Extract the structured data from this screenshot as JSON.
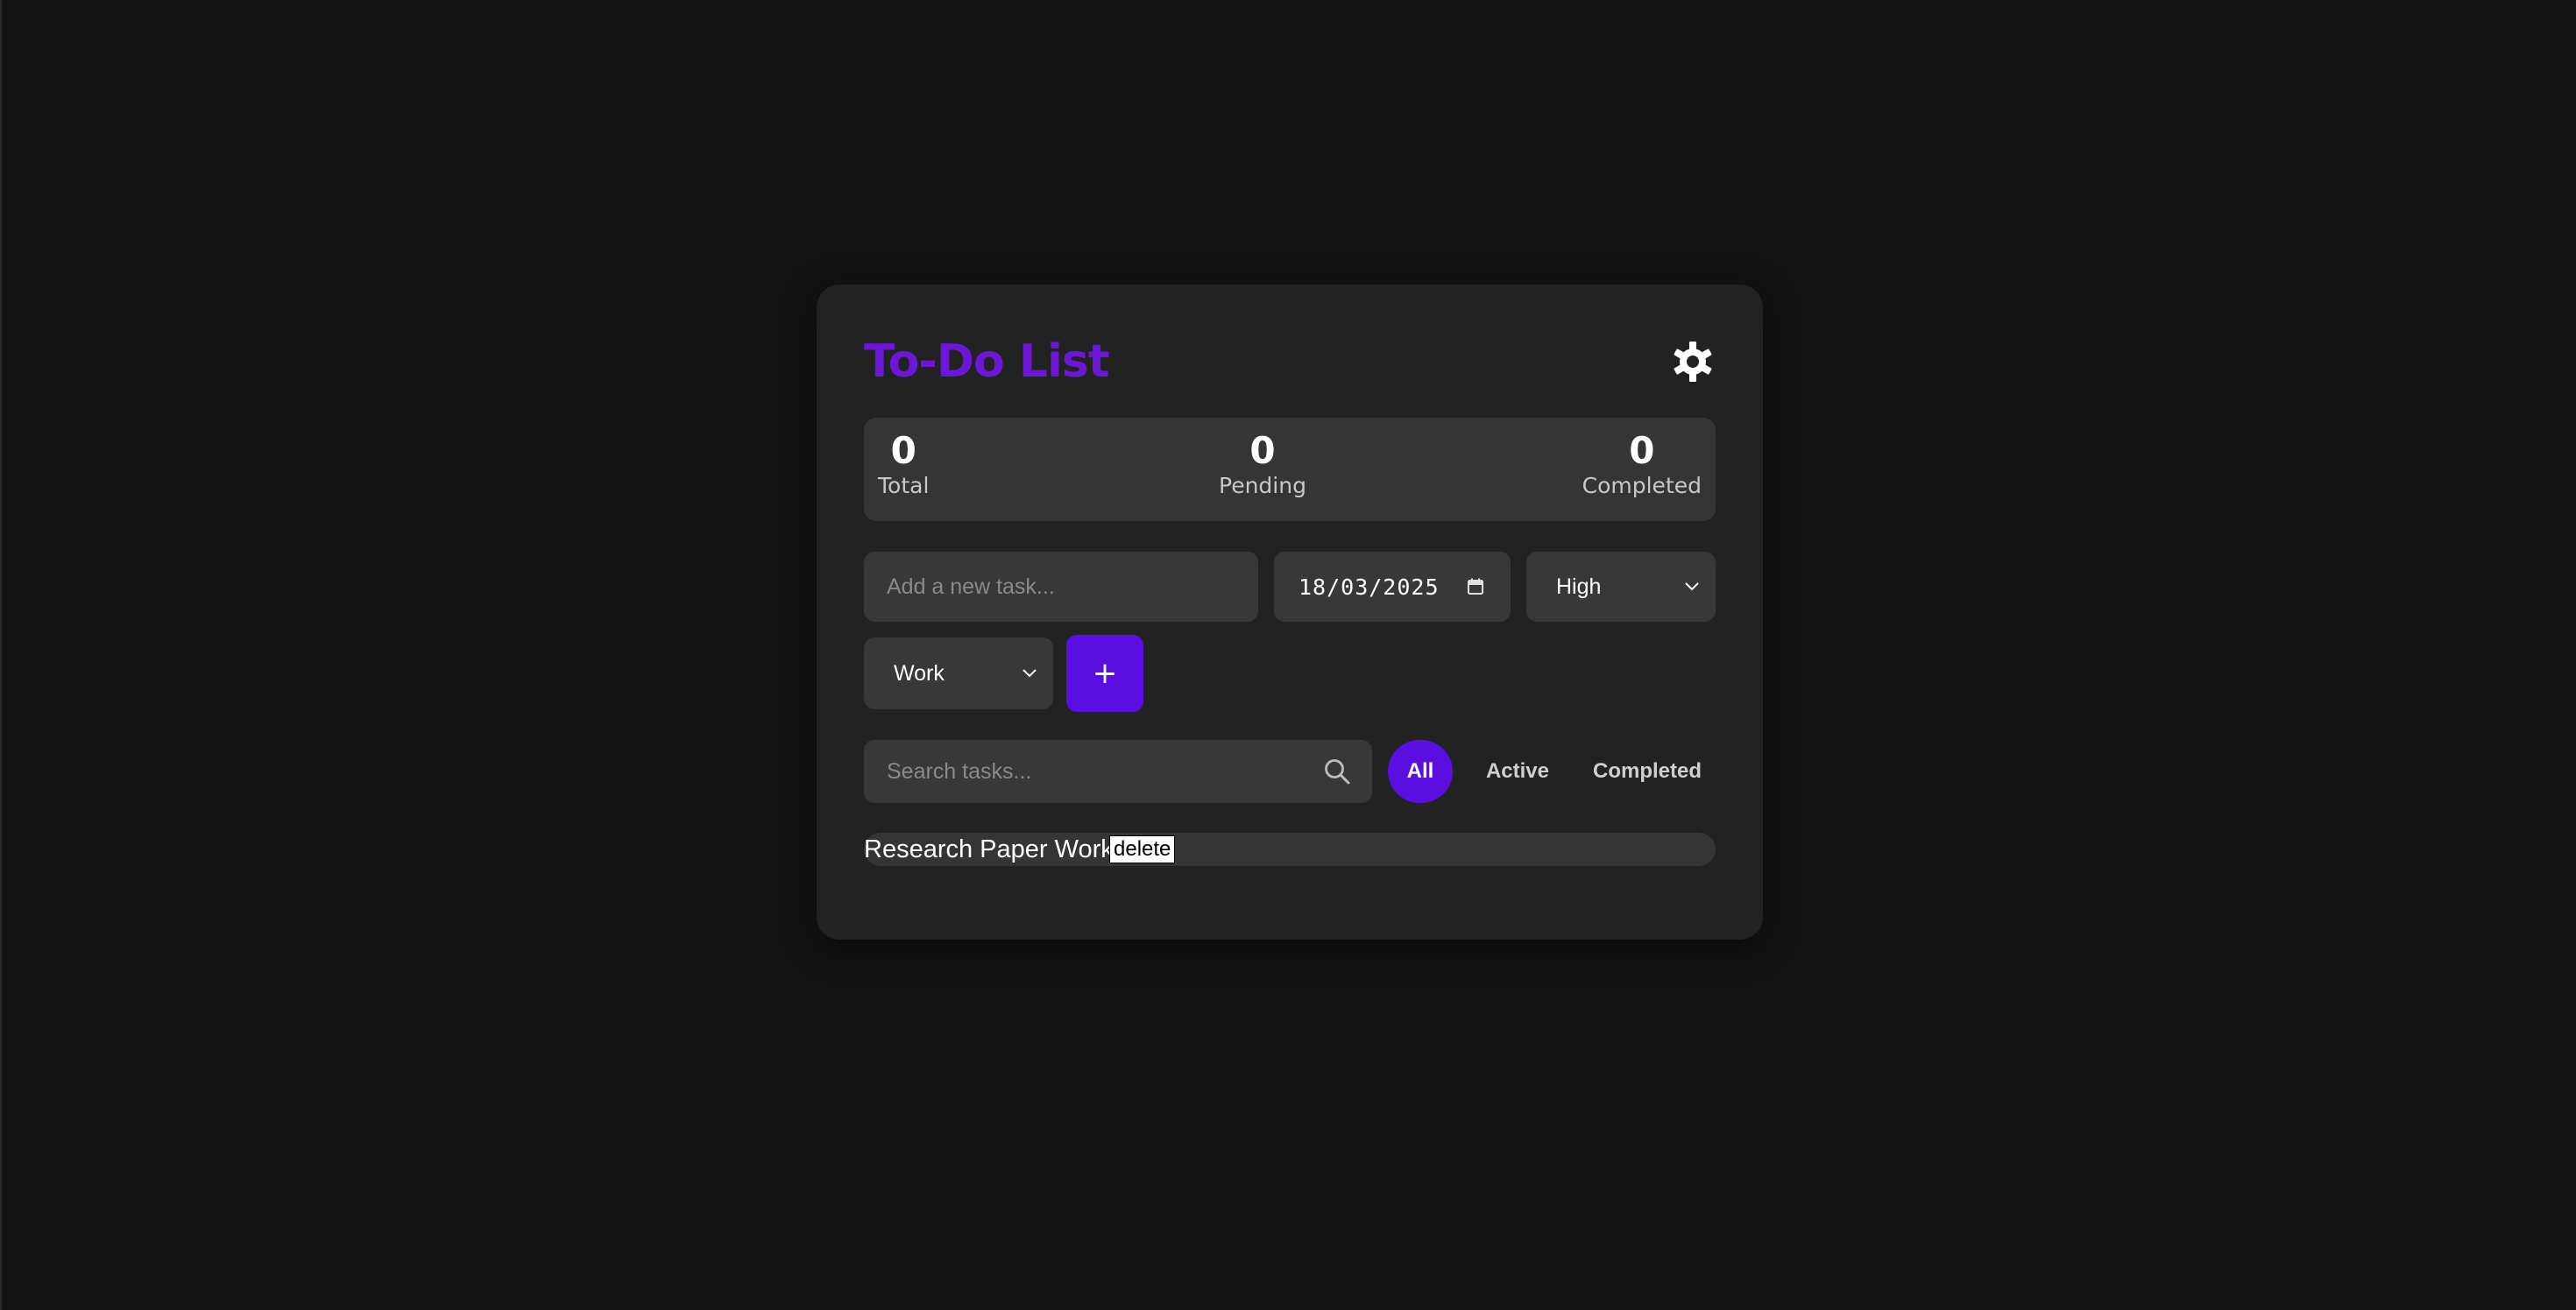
{
  "app": {
    "title": "To-Do List",
    "theme_toggle_icon": "gear-icon"
  },
  "stats": {
    "total": {
      "value": "0",
      "label": "Total"
    },
    "pending": {
      "value": "0",
      "label": "Pending"
    },
    "completed": {
      "value": "0",
      "label": "Completed"
    }
  },
  "form": {
    "task_placeholder": "Add a new task...",
    "date_value": "18/03/2025",
    "priority_value": "High",
    "category_value": "Work",
    "add_label": "+"
  },
  "search": {
    "placeholder": "Search tasks...",
    "icon": "search-icon"
  },
  "filters": [
    {
      "label": "All",
      "active": true
    },
    {
      "label": "Active",
      "active": false
    },
    {
      "label": "Completed",
      "active": false
    }
  ],
  "tasks": [
    {
      "text": "Research Paper Work",
      "delete_label": "delete"
    }
  ],
  "colors": {
    "accent": "#5a0fe0",
    "title": "#6a17d6",
    "background": "#131313",
    "card": "#222222"
  }
}
